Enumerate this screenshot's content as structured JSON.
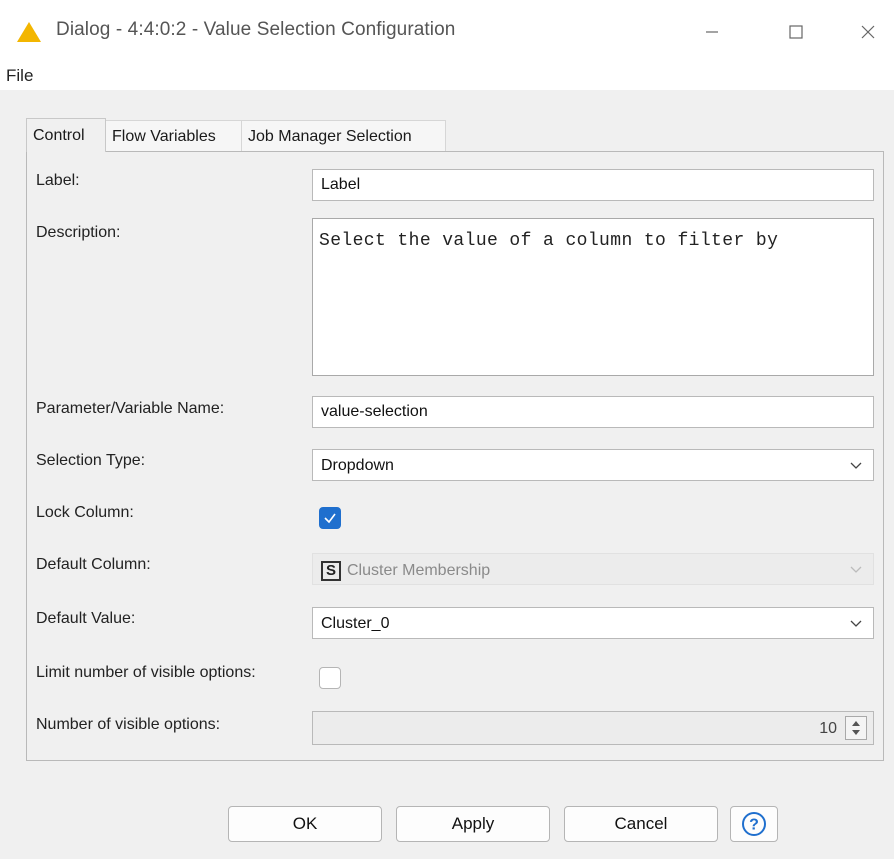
{
  "window": {
    "title": "Dialog - 4:4:0:2 - Value Selection Configuration",
    "warning_color": "#f3b600"
  },
  "menu": {
    "file": "File"
  },
  "tabs": [
    {
      "label": "Control",
      "active": true
    },
    {
      "label": "Flow Variables",
      "active": false
    },
    {
      "label": "Job Manager Selection",
      "active": false
    }
  ],
  "form": {
    "label": {
      "label": "Label:",
      "value": "Label"
    },
    "description": {
      "label": "Description:",
      "value": "Select the value of a column to filter by"
    },
    "parameter_name": {
      "label": "Parameter/Variable Name:",
      "value": "value-selection"
    },
    "selection_type": {
      "label": "Selection Type:",
      "value": "Dropdown"
    },
    "lock_column": {
      "label": "Lock Column:",
      "checked": true
    },
    "default_column": {
      "label": "Default Column:",
      "type_badge": "S",
      "value": "Cluster Membership",
      "disabled": true
    },
    "default_value": {
      "label": "Default Value:",
      "value": "Cluster_0"
    },
    "limit_visible": {
      "label": "Limit number of visible options:",
      "checked": false
    },
    "visible_options": {
      "label": "Number of visible options:",
      "value": "10",
      "disabled": true
    }
  },
  "buttons": {
    "ok": "OK",
    "apply": "Apply",
    "cancel": "Cancel",
    "help_icon": "question-circle-icon"
  },
  "colors": {
    "checkbox_checked": "#1f6fce",
    "help_icon": "#1f6fce"
  }
}
